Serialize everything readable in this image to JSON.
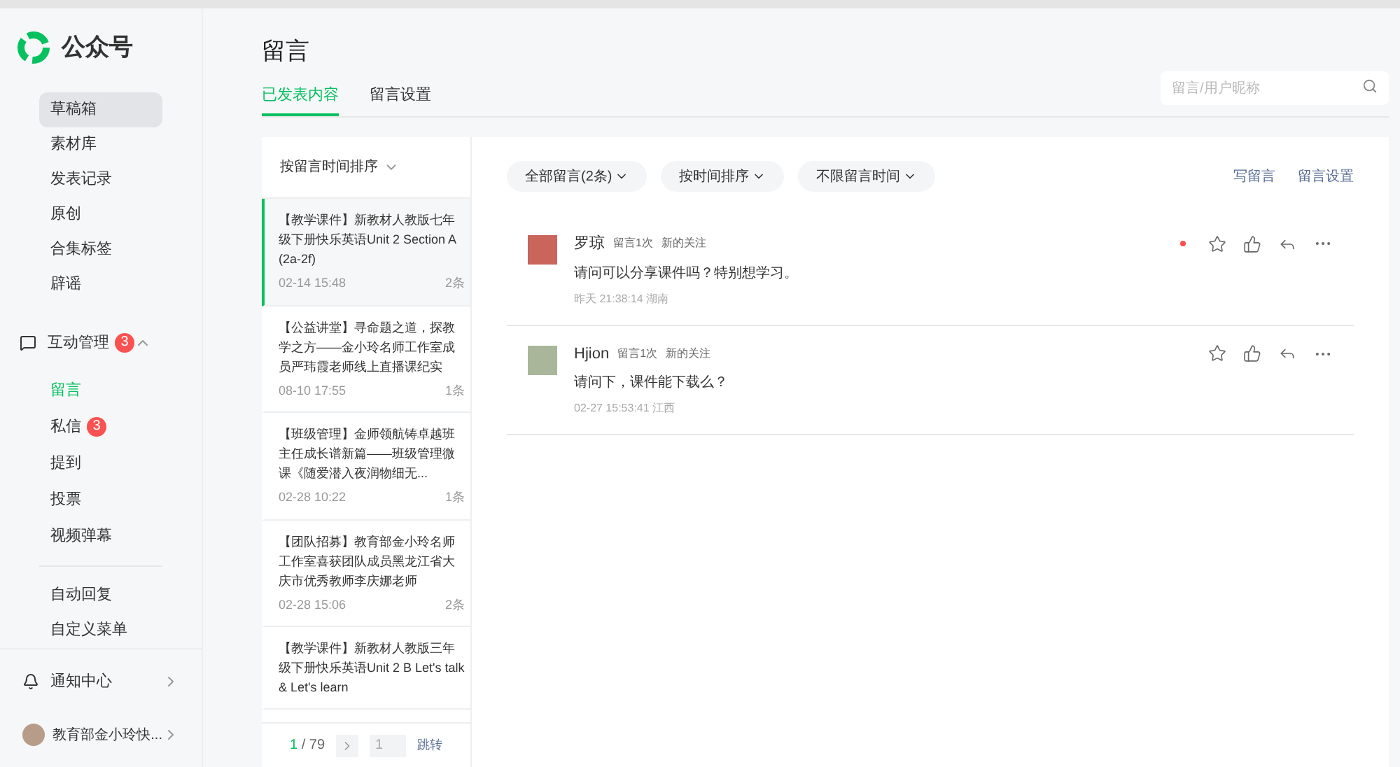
{
  "brand": {
    "name": "公众号"
  },
  "sidebar": {
    "items": [
      {
        "label": "草稿箱",
        "selected": false,
        "hover": true
      },
      {
        "label": "素材库",
        "selected": false,
        "hover": false
      },
      {
        "label": "发表记录",
        "selected": false,
        "hover": false
      },
      {
        "label": "原创",
        "selected": false,
        "hover": false
      },
      {
        "label": "合集标签",
        "selected": false,
        "hover": false
      },
      {
        "label": "辟谣",
        "selected": false,
        "hover": false
      }
    ],
    "section": {
      "label": "互动管理",
      "badge": "3",
      "expanded": true,
      "children": [
        {
          "label": "留言",
          "selected": true
        },
        {
          "label": "私信",
          "selected": false,
          "badge": "3"
        },
        {
          "label": "提到",
          "selected": false
        },
        {
          "label": "投票",
          "selected": false
        },
        {
          "label": "视频弹幕",
          "selected": false
        }
      ]
    },
    "more_items": [
      {
        "label": "自动回复",
        "selected": false
      },
      {
        "label": "自定义菜单",
        "selected": false
      }
    ],
    "notifications": {
      "label": "通知中心"
    },
    "account": {
      "name": "教育部金小玲快..."
    }
  },
  "page": {
    "title": "留言",
    "tabs": [
      {
        "label": "已发表内容",
        "selected": true
      },
      {
        "label": "留言设置",
        "selected": false
      }
    ],
    "search": {
      "placeholder": "留言/用户昵称"
    }
  },
  "articles": {
    "sort": "按留言时间排序",
    "items": [
      {
        "title": "【教学课件】新教材人教版七年级下册快乐英语Unit 2 Section A (2a-2f)",
        "date": "02-14 15:48",
        "count": "2条",
        "selected": true
      },
      {
        "title": "【公益讲堂】寻命题之道，探教学之方——金小玲名师工作室成员严玮霞老师线上直播课纪实",
        "date": "08-10 17:55",
        "count": "1条",
        "selected": false
      },
      {
        "title": "【班级管理】金师领航铸卓越班主任成长谱新篇——班级管理微课《随爱潜入夜润物细无...",
        "date": "02-28 10:22",
        "count": "1条",
        "selected": false
      },
      {
        "title": "【团队招募】教育部金小玲名师工作室喜获团队成员黑龙江省大庆市优秀教师李庆娜老师",
        "date": "02-28 15:06",
        "count": "2条",
        "selected": false
      },
      {
        "title": "【教学课件】新教材人教版三年级下册快乐英语Unit 2 B Let's talk & Let's learn",
        "selected": false
      }
    ],
    "pagination": {
      "current": "1",
      "total": "/ 79",
      "placeholder": "1",
      "jump": "跳转"
    }
  },
  "comments": {
    "filters": [
      "全部留言(2条)",
      "按时间排序",
      "不限留言时间"
    ],
    "links": [
      "写留言",
      "留言设置"
    ],
    "items": [
      {
        "name": "罗琼",
        "count": "留言1次",
        "tag": "新的关注",
        "text": "请问可以分享课件吗？特别想学习。",
        "meta": "昨天 21:38:14 湖南",
        "unread": true
      },
      {
        "name": "Hjion",
        "count": "留言1次",
        "tag": "新的关注",
        "text": "请问下，课件能下载么？",
        "meta": "02-27 15:53:41 江西",
        "unread": false
      }
    ]
  }
}
